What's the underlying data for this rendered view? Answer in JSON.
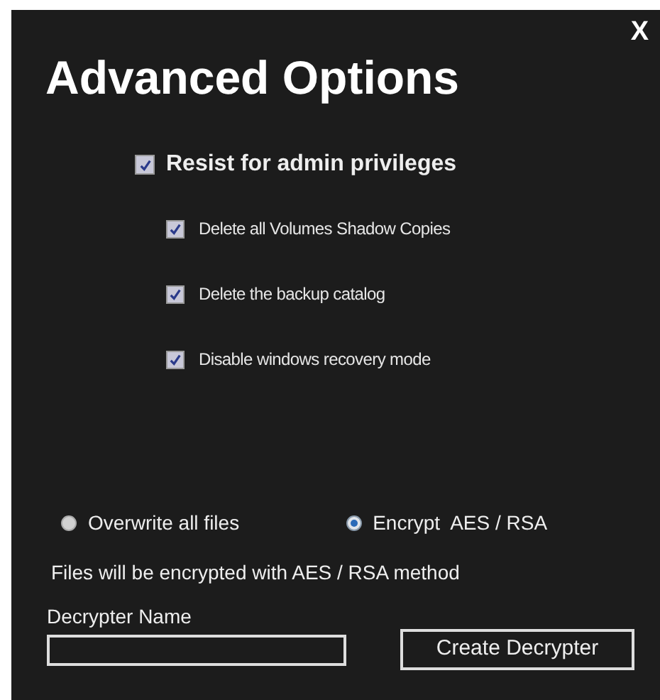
{
  "close_button": "X",
  "title": "Advanced Options",
  "main_option": {
    "label": "Resist for admin privileges",
    "checked": true
  },
  "sub_options": [
    {
      "label": "Delete all Volumes Shadow Copies",
      "checked": true
    },
    {
      "label": "Delete the backup catalog",
      "checked": true
    },
    {
      "label": "Disable windows recovery mode",
      "checked": true
    }
  ],
  "modes": [
    {
      "label": "Overwrite all files",
      "selected": false
    },
    {
      "label": "Encrypt  AES / RSA",
      "selected": true
    }
  ],
  "note": "Files will be encrypted with AES / RSA method",
  "decrypter_name": {
    "label": "Decrypter Name"
  },
  "create_button": "Create Decrypter"
}
